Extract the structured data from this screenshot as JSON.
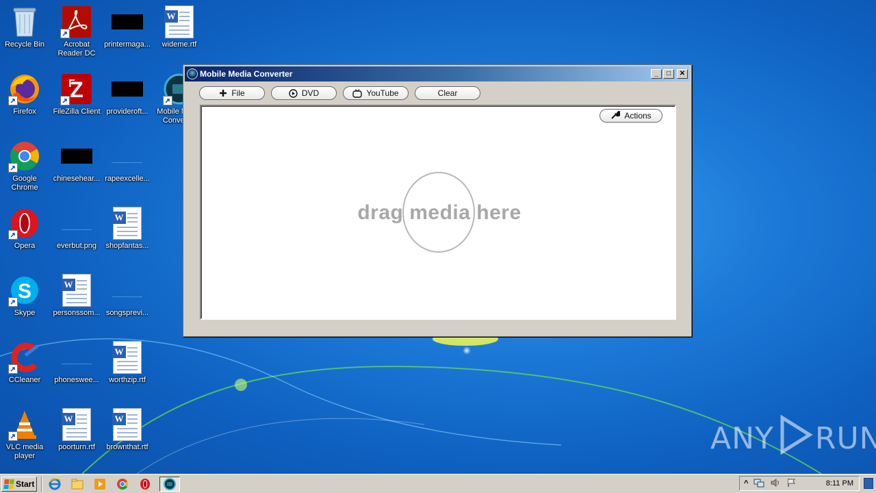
{
  "desktop": {
    "icons": [
      {
        "label": "Recycle Bin",
        "icon": "recycle-bin-icon"
      },
      {
        "label": "Acrobat Reader DC",
        "icon": "acrobat-icon"
      },
      {
        "label": "printermaga...",
        "icon": "file-icon"
      },
      {
        "label": "wideme.rtf",
        "icon": "word-document-icon"
      },
      {
        "label": "Firefox",
        "icon": "firefox-icon"
      },
      {
        "label": "FileZilla Client",
        "icon": "filezilla-icon"
      },
      {
        "label": "provideroft...",
        "icon": "file-icon"
      },
      {
        "label": "Mobile Media Converter",
        "icon": "mobile-media-converter-icon"
      },
      {
        "label": "Google Chrome",
        "icon": "chrome-icon"
      },
      {
        "label": "chinesehear...",
        "icon": "file-icon"
      },
      {
        "label": "rapeexcelle...",
        "icon": "file-icon"
      },
      {
        "label": "Opera",
        "icon": "opera-icon"
      },
      {
        "label": "everbut.png",
        "icon": "image-file-icon"
      },
      {
        "label": "shopfantas...",
        "icon": "word-document-icon"
      },
      {
        "label": "Skype",
        "icon": "skype-icon"
      },
      {
        "label": "personssom...",
        "icon": "word-document-icon"
      },
      {
        "label": "songsprevi...",
        "icon": "file-icon"
      },
      {
        "label": "CCleaner",
        "icon": "ccleaner-icon"
      },
      {
        "label": "phoneswee...",
        "icon": "file-icon"
      },
      {
        "label": "worthzip.rtf",
        "icon": "word-document-icon"
      },
      {
        "label": "VLC media player",
        "icon": "vlc-icon"
      },
      {
        "label": "poorturn.rtf",
        "icon": "word-document-icon"
      },
      {
        "label": "brownthat.rtf",
        "icon": "word-document-icon"
      }
    ]
  },
  "window": {
    "title": "Mobile Media Converter",
    "controls": {
      "minimize": "_",
      "maximize": "□",
      "close": "✕"
    },
    "toolbar": {
      "file_label": "File",
      "dvd_label": "DVD",
      "youtube_label": "YouTube",
      "clear_label": "Clear"
    },
    "actions_label": "Actions",
    "drop": {
      "word1": "drag",
      "word2": "media",
      "word3": "here"
    }
  },
  "taskbar": {
    "start_label": "Start",
    "clock": "8:11 PM",
    "tray_arrow": "^"
  },
  "watermark": {
    "left": "ANY",
    "right": "RUN"
  }
}
